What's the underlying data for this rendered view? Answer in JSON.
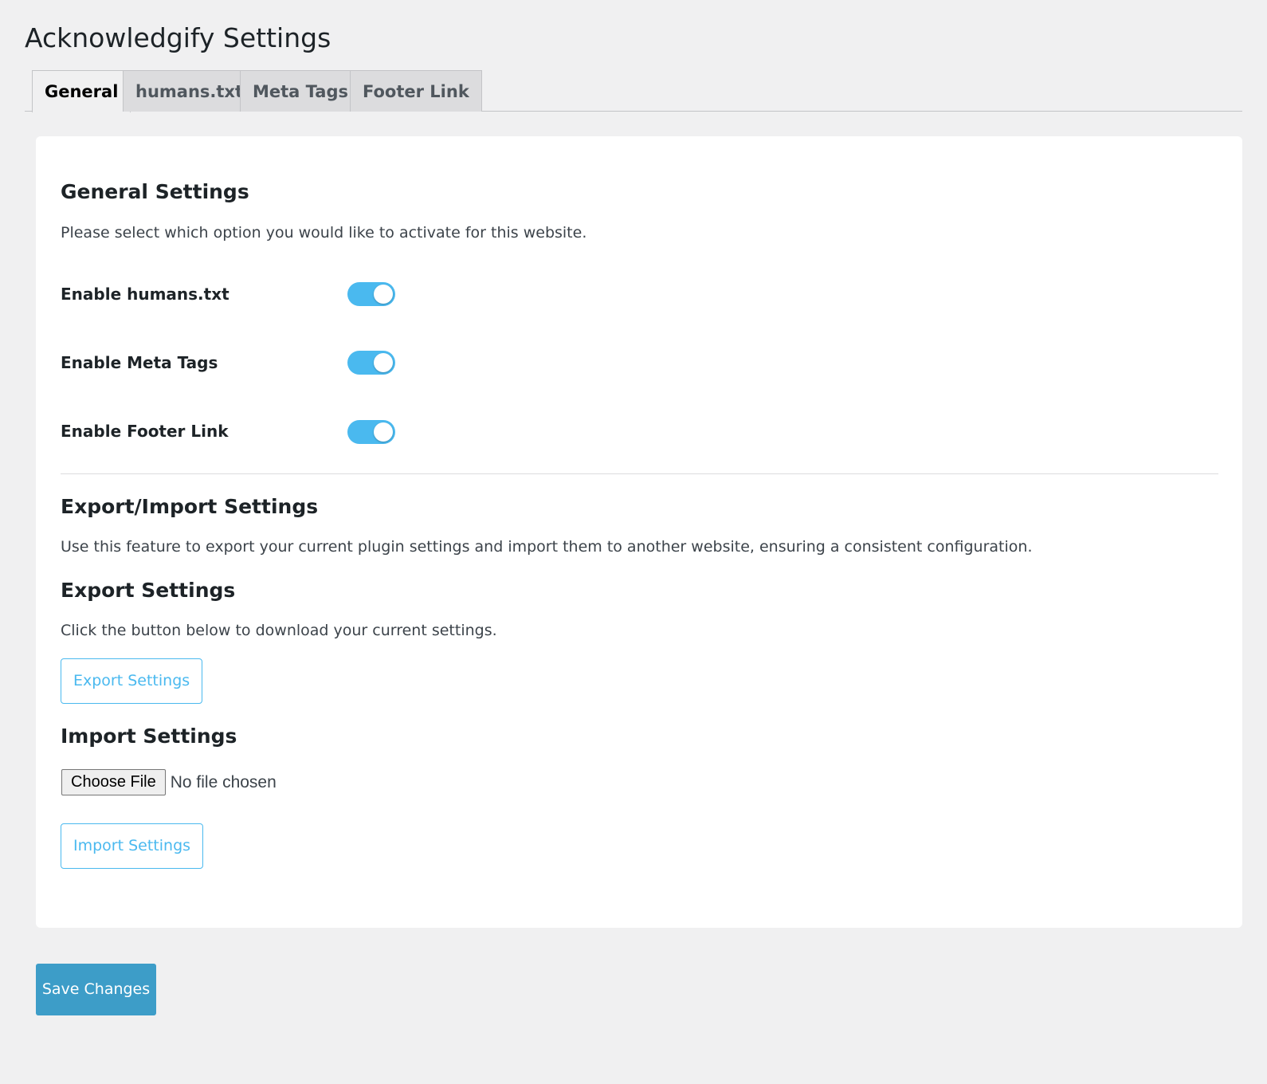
{
  "page": {
    "title": "Acknowledgify Settings"
  },
  "tabs": [
    {
      "label": "General",
      "active": true
    },
    {
      "label": "humans.txt",
      "active": false
    },
    {
      "label": "Meta Tags",
      "active": false
    },
    {
      "label": "Footer Link",
      "active": false
    }
  ],
  "general": {
    "heading": "General Settings",
    "description": "Please select which option you would like to activate for this website.",
    "toggles": [
      {
        "label": "Enable humans.txt",
        "enabled": true
      },
      {
        "label": "Enable Meta Tags",
        "enabled": true
      },
      {
        "label": "Enable Footer Link",
        "enabled": true
      }
    ]
  },
  "export_import": {
    "heading": "Export/Import Settings",
    "description": "Use this feature to export your current plugin settings and import them to another website, ensuring a consistent configuration.",
    "export": {
      "heading": "Export Settings",
      "description": "Click the button below to download your current settings.",
      "button_label": "Export Settings"
    },
    "import": {
      "heading": "Import Settings",
      "choose_file_label": "Choose File",
      "file_status": "No file chosen",
      "button_label": "Import Settings"
    }
  },
  "footer": {
    "save_label": "Save Changes"
  },
  "colors": {
    "accent": "#4ab9ef",
    "primary_button": "#3d9dc8",
    "background": "#f0f0f1"
  }
}
